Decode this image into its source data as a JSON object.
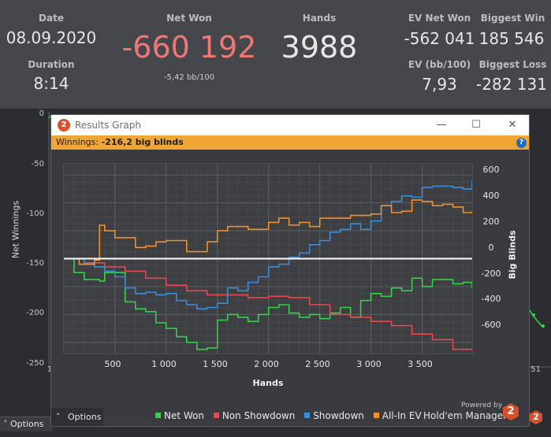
{
  "stats": {
    "date_label": "Date",
    "date_value": "08.09.2020",
    "duration_label": "Duration",
    "duration_value": "8:14",
    "net_won_label": "Net Won",
    "net_won_value": "-660 192",
    "net_won_sub": "-5,42 bb/100",
    "hands_label": "Hands",
    "hands_value": "3988",
    "ev_net_won_label": "EV Net Won",
    "ev_net_won_value": "-562 041",
    "ev_bb_label": "EV (bb/100)",
    "ev_bb_value": "7,93",
    "biggest_win_label": "Biggest Win",
    "biggest_win_value": "185 546",
    "biggest_loss_label": "Biggest Loss",
    "biggest_loss_value": "-282 131",
    "net_won_color": "#f07777"
  },
  "background_chart": {
    "y_label": "Net Winnings",
    "y_ticks": [
      "0",
      "-50",
      "-100",
      "-150",
      "-200",
      "-250"
    ],
    "x_tick_left": "1",
    "x_tick_right": "51",
    "options_label": "Options"
  },
  "window": {
    "title": "Results Graph",
    "icon_glyph": "2",
    "minimize_glyph": "—",
    "maximize_glyph": "☐",
    "close_glyph": "✕",
    "banner_label": "Winnings:",
    "banner_value": "-216,2 big blinds",
    "help_glyph": "?",
    "options_label": "Options",
    "powered_by": "Powered by",
    "brand": "Hold'em Manager",
    "brand_glyph": "2"
  },
  "chart_data": {
    "type": "line",
    "xlabel": "Hands",
    "ylabel": "Big Blinds",
    "x_ticks": [
      "500",
      "1 000",
      "1 500",
      "2 000",
      "2 500",
      "3 000",
      "3 500"
    ],
    "x_tick_values": [
      500,
      1000,
      1500,
      2000,
      2500,
      3000,
      3500
    ],
    "y_ticks": [
      "600",
      "400",
      "200",
      "0",
      "-200",
      "-400",
      "-600"
    ],
    "y_tick_values": [
      600,
      400,
      200,
      0,
      -200,
      -400,
      -600
    ],
    "xlim": [
      1,
      3988
    ],
    "ylim": [
      -680,
      680
    ],
    "grid": true,
    "zero_line_color": "#ffffff",
    "series": [
      {
        "name": "Net Won",
        "color": "#33d24a",
        "x": [
          1,
          100,
          200,
          350,
          400,
          600,
          700,
          800,
          900,
          1000,
          1100,
          1200,
          1300,
          1400,
          1500,
          1600,
          1700,
          1800,
          1900,
          2000,
          2100,
          2200,
          2300,
          2400,
          2500,
          2600,
          2700,
          2800,
          2900,
          3000,
          3100,
          3200,
          3300,
          3400,
          3500,
          3600,
          3700,
          3800,
          3900,
          3988
        ],
        "y": [
          0,
          -100,
          -150,
          -160,
          -100,
          -310,
          -360,
          -380,
          -460,
          -500,
          -560,
          -600,
          -650,
          -640,
          -440,
          -400,
          -420,
          -450,
          -400,
          -350,
          -330,
          -390,
          -420,
          -400,
          -430,
          -390,
          -350,
          -420,
          -300,
          -250,
          -270,
          -210,
          -230,
          -140,
          -200,
          -150,
          -150,
          -180,
          -170,
          -210
        ]
      },
      {
        "name": "Non Showdown",
        "color": "#e8474f",
        "x": [
          1,
          200,
          400,
          600,
          800,
          1000,
          1200,
          1400,
          1600,
          1800,
          2000,
          2200,
          2400,
          2600,
          2800,
          3000,
          3200,
          3400,
          3600,
          3800,
          3988
        ],
        "y": [
          0,
          -30,
          -60,
          -90,
          -140,
          -190,
          -230,
          -260,
          -260,
          -280,
          -270,
          -280,
          -330,
          -400,
          -420,
          -450,
          -480,
          -540,
          -580,
          -650,
          -660
        ]
      },
      {
        "name": "Showdown",
        "color": "#3b8ddc",
        "x": [
          1,
          200,
          300,
          400,
          500,
          600,
          700,
          800,
          900,
          1000,
          1100,
          1200,
          1300,
          1400,
          1500,
          1600,
          1700,
          1800,
          1900,
          2000,
          2100,
          2200,
          2300,
          2400,
          2500,
          2600,
          2700,
          2800,
          2900,
          3000,
          3100,
          3200,
          3300,
          3400,
          3500,
          3600,
          3700,
          3800,
          3900,
          3988
        ],
        "y": [
          0,
          -40,
          -60,
          -90,
          -130,
          -210,
          -250,
          -240,
          -260,
          -250,
          -300,
          -330,
          -360,
          -350,
          -320,
          -210,
          -230,
          -170,
          -130,
          -60,
          -40,
          10,
          40,
          100,
          130,
          190,
          210,
          250,
          210,
          270,
          380,
          410,
          450,
          440,
          510,
          520,
          520,
          510,
          500,
          560
        ]
      },
      {
        "name": "All-In EV",
        "color": "#f0912f",
        "x": [
          1,
          150,
          300,
          350,
          400,
          500,
          700,
          800,
          900,
          1000,
          1200,
          1400,
          1500,
          1600,
          1800,
          2000,
          2100,
          2200,
          2300,
          2400,
          2500,
          2600,
          2800,
          3000,
          3100,
          3200,
          3300,
          3400,
          3500,
          3600,
          3700,
          3800,
          3900,
          3988
        ],
        "y": [
          0,
          -40,
          -10,
          240,
          200,
          150,
          80,
          90,
          120,
          130,
          50,
          120,
          200,
          230,
          210,
          260,
          290,
          240,
          260,
          230,
          290,
          290,
          310,
          320,
          380,
          330,
          340,
          420,
          410,
          380,
          390,
          370,
          330,
          340
        ]
      }
    ]
  }
}
